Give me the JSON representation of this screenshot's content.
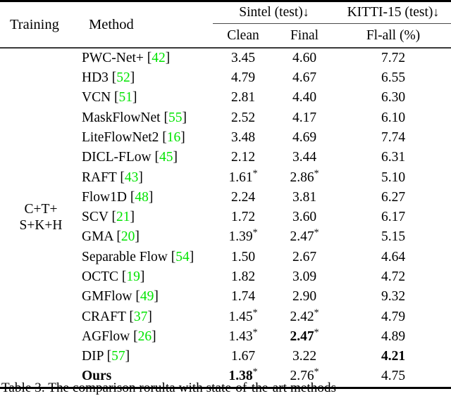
{
  "table": {
    "header": {
      "col_training": "Training",
      "col_method": "Method",
      "group_sintel": "Sintel (test)",
      "group_kitti": "KITTI-15 (test)",
      "arrow_glyph": "↓",
      "sub_clean": "Clean",
      "sub_final": "Final",
      "sub_flall": "Fl-all (%)"
    },
    "training_label_line1": "C+T+",
    "training_label_line2": "S+K+H",
    "citation_color": "#00e400",
    "rows": [
      {
        "method": "PWC-Net+",
        "cite": "42",
        "clean": "3.45",
        "clean_star": false,
        "clean_bold": false,
        "final": "4.60",
        "final_star": false,
        "final_bold": false,
        "flall": "7.72",
        "flall_bold": false,
        "method_bold": false
      },
      {
        "method": "HD3",
        "cite": "52",
        "clean": "4.79",
        "clean_star": false,
        "clean_bold": false,
        "final": "4.67",
        "final_star": false,
        "final_bold": false,
        "flall": "6.55",
        "flall_bold": false,
        "method_bold": false
      },
      {
        "method": "VCN",
        "cite": "51",
        "clean": "2.81",
        "clean_star": false,
        "clean_bold": false,
        "final": "4.40",
        "final_star": false,
        "final_bold": false,
        "flall": "6.30",
        "flall_bold": false,
        "method_bold": false
      },
      {
        "method": "MaskFlowNet",
        "cite": "55",
        "clean": "2.52",
        "clean_star": false,
        "clean_bold": false,
        "final": "4.17",
        "final_star": false,
        "final_bold": false,
        "flall": "6.10",
        "flall_bold": false,
        "method_bold": false
      },
      {
        "method": "LiteFlowNet2",
        "cite": "16",
        "clean": "3.48",
        "clean_star": false,
        "clean_bold": false,
        "final": "4.69",
        "final_star": false,
        "final_bold": false,
        "flall": "7.74",
        "flall_bold": false,
        "method_bold": false
      },
      {
        "method": "DICL-FLow",
        "cite": "45",
        "clean": "2.12",
        "clean_star": false,
        "clean_bold": false,
        "final": "3.44",
        "final_star": false,
        "final_bold": false,
        "flall": "6.31",
        "flall_bold": false,
        "method_bold": false
      },
      {
        "method": "RAFT",
        "cite": "43",
        "clean": "1.61",
        "clean_star": true,
        "clean_bold": false,
        "final": "2.86",
        "final_star": true,
        "final_bold": false,
        "flall": "5.10",
        "flall_bold": false,
        "method_bold": false
      },
      {
        "method": "Flow1D",
        "cite": "48",
        "clean": "2.24",
        "clean_star": false,
        "clean_bold": false,
        "final": "3.81",
        "final_star": false,
        "final_bold": false,
        "flall": "6.27",
        "flall_bold": false,
        "method_bold": false
      },
      {
        "method": "SCV",
        "cite": "21",
        "clean": "1.72",
        "clean_star": false,
        "clean_bold": false,
        "final": "3.60",
        "final_star": false,
        "final_bold": false,
        "flall": "6.17",
        "flall_bold": false,
        "method_bold": false
      },
      {
        "method": "GMA",
        "cite": "20",
        "clean": "1.39",
        "clean_star": true,
        "clean_bold": false,
        "final": "2.47",
        "final_star": true,
        "final_bold": false,
        "flall": "5.15",
        "flall_bold": false,
        "method_bold": false
      },
      {
        "method": "Separable Flow",
        "cite": "54",
        "clean": "1.50",
        "clean_star": false,
        "clean_bold": false,
        "final": "2.67",
        "final_star": false,
        "final_bold": false,
        "flall": "4.64",
        "flall_bold": false,
        "method_bold": false
      },
      {
        "method": "OCTC",
        "cite": "19",
        "clean": "1.82",
        "clean_star": false,
        "clean_bold": false,
        "final": "3.09",
        "final_star": false,
        "final_bold": false,
        "flall": "4.72",
        "flall_bold": false,
        "method_bold": false
      },
      {
        "method": "GMFlow",
        "cite": "49",
        "clean": "1.74",
        "clean_star": false,
        "clean_bold": false,
        "final": "2.90",
        "final_star": false,
        "final_bold": false,
        "flall": "9.32",
        "flall_bold": false,
        "method_bold": false
      },
      {
        "method": "CRAFT",
        "cite": "37",
        "clean": "1.45",
        "clean_star": true,
        "clean_bold": false,
        "final": "2.42",
        "final_star": true,
        "final_bold": false,
        "flall": "4.79",
        "flall_bold": false,
        "method_bold": false
      },
      {
        "method": "AGFlow",
        "cite": "26",
        "clean": "1.43",
        "clean_star": true,
        "clean_bold": false,
        "final": "2.47",
        "final_star": true,
        "final_bold": true,
        "flall": "4.89",
        "flall_bold": false,
        "method_bold": false
      },
      {
        "method": "DIP",
        "cite": "57",
        "clean": "1.67",
        "clean_star": false,
        "clean_bold": false,
        "final": "3.22",
        "final_star": false,
        "final_bold": false,
        "flall": "4.21",
        "flall_bold": true,
        "method_bold": false
      },
      {
        "method": "Ours",
        "cite": "",
        "clean": "1.38",
        "clean_star": true,
        "clean_bold": true,
        "final": "2.76",
        "final_star": true,
        "final_bold": false,
        "flall": "4.75",
        "flall_bold": false,
        "method_bold": true
      }
    ]
  },
  "caption": {
    "label": "Table 3.",
    "text": "The comparison rorulta with state-of-the-art methods"
  }
}
